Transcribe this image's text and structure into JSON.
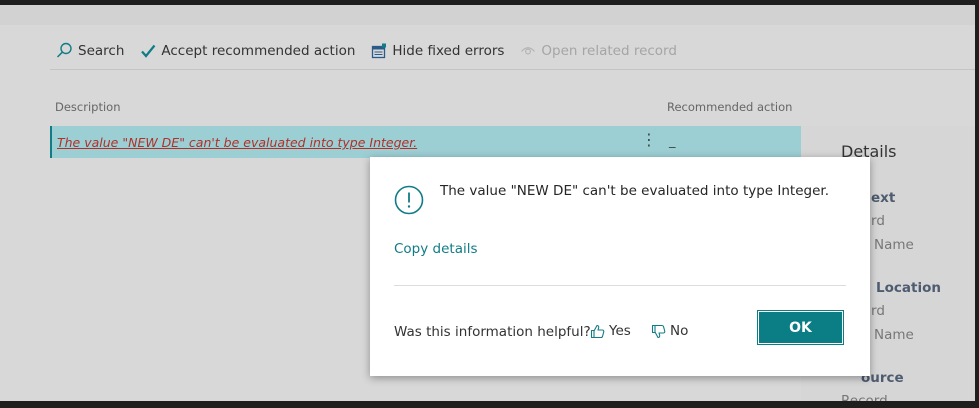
{
  "toolbar": {
    "search_label": "Search",
    "accept_label": "Accept recommended action",
    "hide_label": "Hide fixed errors",
    "open_label": "Open related record"
  },
  "table": {
    "headers": {
      "description": "Description",
      "recommended": "Recommended action"
    },
    "rows": [
      {
        "description": "The value \"NEW DE\" can't be evaluated into type Integer.",
        "recommended": "_"
      }
    ]
  },
  "details": {
    "title": "Details",
    "sections": [
      {
        "heading": "ext",
        "lines": [
          "rd",
          "Name"
        ]
      },
      {
        "heading": "Location",
        "lines": [
          "rd",
          "Name"
        ]
      },
      {
        "heading": "ource",
        "lines": [
          "Record"
        ]
      }
    ]
  },
  "dialog": {
    "message": "The value \"NEW DE\" can't be evaluated into type Integer.",
    "copy_details": "Copy details",
    "helpful_question": "Was this information helpful?",
    "yes_label": "Yes",
    "no_label": "No",
    "ok_label": "OK"
  },
  "colors": {
    "accent": "#117c86",
    "selected_row": "#9ccfd4",
    "error_text": "#b0302a"
  },
  "icons": [
    "search-icon",
    "checkmark-icon",
    "hide-errors-icon",
    "open-record-icon",
    "info-icon",
    "thumbs-up-icon",
    "thumbs-down-icon",
    "more-options-icon"
  ]
}
